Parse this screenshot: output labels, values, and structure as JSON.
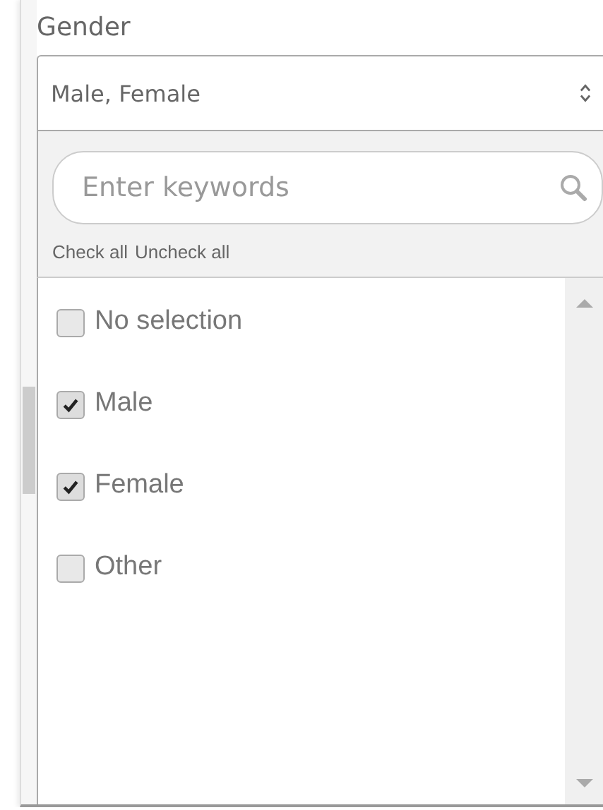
{
  "field_label": "Gender",
  "select": {
    "value": "Male, Female"
  },
  "dropdown": {
    "search": {
      "placeholder": "Enter keywords"
    },
    "links": [
      "Check all",
      "Uncheck all"
    ],
    "options": [
      {
        "label": "No selection",
        "checked": false
      },
      {
        "label": "Male",
        "checked": true
      },
      {
        "label": "Female",
        "checked": true
      },
      {
        "label": "Other",
        "checked": false
      }
    ]
  }
}
